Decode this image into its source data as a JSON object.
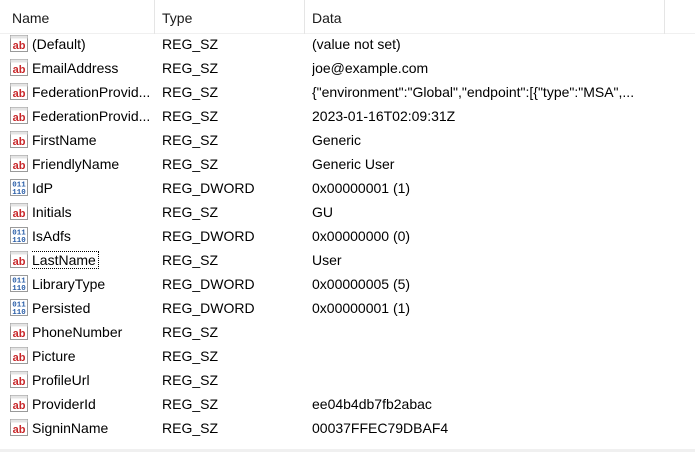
{
  "columns": {
    "name": "Name",
    "type": "Type",
    "data": "Data"
  },
  "icons": {
    "string": "reg-sz-icon",
    "dword": "reg-dword-icon"
  },
  "colors": {
    "sz_red": "#c8282b",
    "dword_blue": "#2a5ea8"
  },
  "rows": [
    {
      "name": "(Default)",
      "type": "REG_SZ",
      "data": "(value not set)",
      "icon": "string"
    },
    {
      "name": "EmailAddress",
      "type": "REG_SZ",
      "data": "joe@example.com",
      "icon": "string"
    },
    {
      "name": "FederationProvid...",
      "type": "REG_SZ",
      "data": "{\"environment\":\"Global\",\"endpoint\":[{\"type\":\"MSA\",...",
      "icon": "string"
    },
    {
      "name": "FederationProvid...",
      "type": "REG_SZ",
      "data": "2023-01-16T02:09:31Z",
      "icon": "string"
    },
    {
      "name": "FirstName",
      "type": "REG_SZ",
      "data": "Generic",
      "icon": "string"
    },
    {
      "name": "FriendlyName",
      "type": "REG_SZ",
      "data": "Generic User",
      "icon": "string"
    },
    {
      "name": "IdP",
      "type": "REG_DWORD",
      "data": "0x00000001 (1)",
      "icon": "dword"
    },
    {
      "name": "Initials",
      "type": "REG_SZ",
      "data": "GU",
      "icon": "string"
    },
    {
      "name": "IsAdfs",
      "type": "REG_DWORD",
      "data": "0x00000000 (0)",
      "icon": "dword"
    },
    {
      "name": "LastName",
      "type": "REG_SZ",
      "data": "User",
      "icon": "string",
      "focused": true
    },
    {
      "name": "LibraryType",
      "type": "REG_DWORD",
      "data": "0x00000005 (5)",
      "icon": "dword"
    },
    {
      "name": "Persisted",
      "type": "REG_DWORD",
      "data": "0x00000001 (1)",
      "icon": "dword"
    },
    {
      "name": "PhoneNumber",
      "type": "REG_SZ",
      "data": "",
      "icon": "string"
    },
    {
      "name": "Picture",
      "type": "REG_SZ",
      "data": "",
      "icon": "string"
    },
    {
      "name": "ProfileUrl",
      "type": "REG_SZ",
      "data": "",
      "icon": "string"
    },
    {
      "name": "ProviderId",
      "type": "REG_SZ",
      "data": "ee04b4db7fb2abac",
      "icon": "string"
    },
    {
      "name": "SigninName",
      "type": "REG_SZ",
      "data": "00037FFEC79DBAF4",
      "icon": "string"
    }
  ]
}
